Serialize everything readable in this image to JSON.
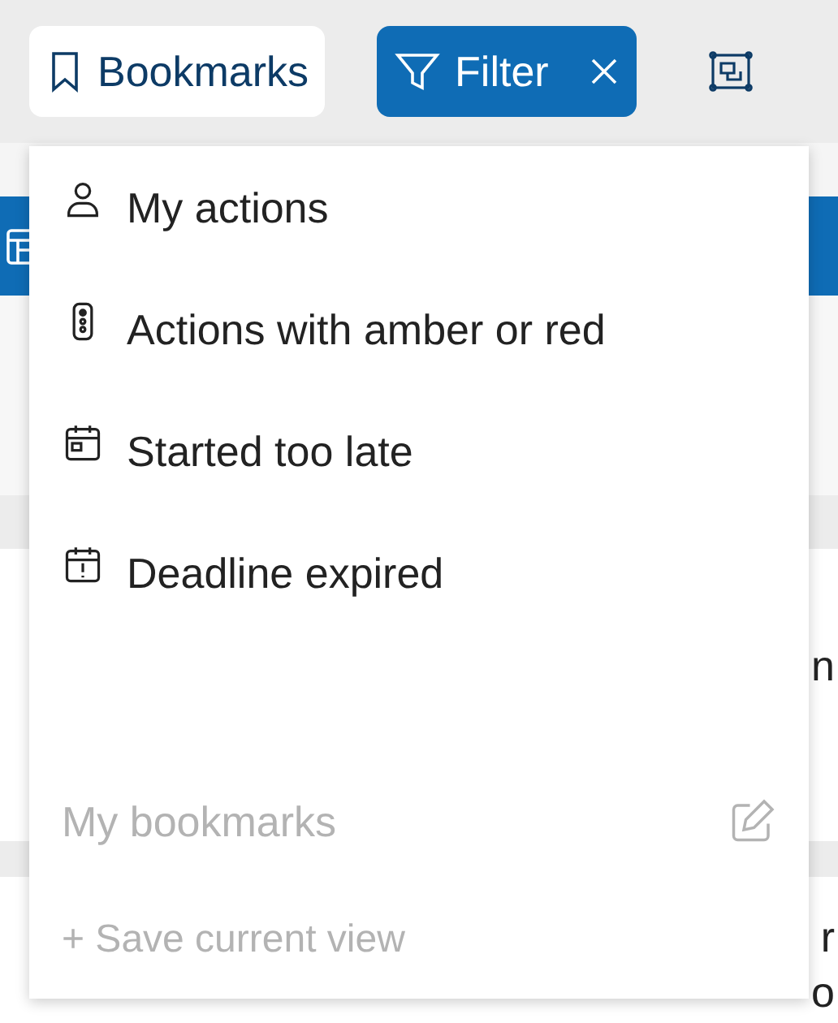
{
  "toolbar": {
    "buttons": [
      {
        "kind": "bookmark",
        "label": "Bookmarks",
        "selected": false
      },
      {
        "kind": "filter",
        "label": "Filter",
        "selected": true,
        "clearable": true
      },
      {
        "kind": "view",
        "selected": false
      }
    ]
  },
  "background": {
    "fragments": [
      "n",
      "r",
      "o"
    ]
  },
  "dropdown": {
    "items": [
      {
        "kind": "person",
        "label": "My actions"
      },
      {
        "kind": "traffic-light",
        "label": "Actions with amber or red"
      },
      {
        "kind": "calendar",
        "label": "Started too late"
      },
      {
        "kind": "calendar-alert",
        "label": "Deadline expired"
      }
    ],
    "section": {
      "label": "My bookmarks"
    },
    "save_action": {
      "label": "+ Save current view",
      "disabled": true
    }
  }
}
